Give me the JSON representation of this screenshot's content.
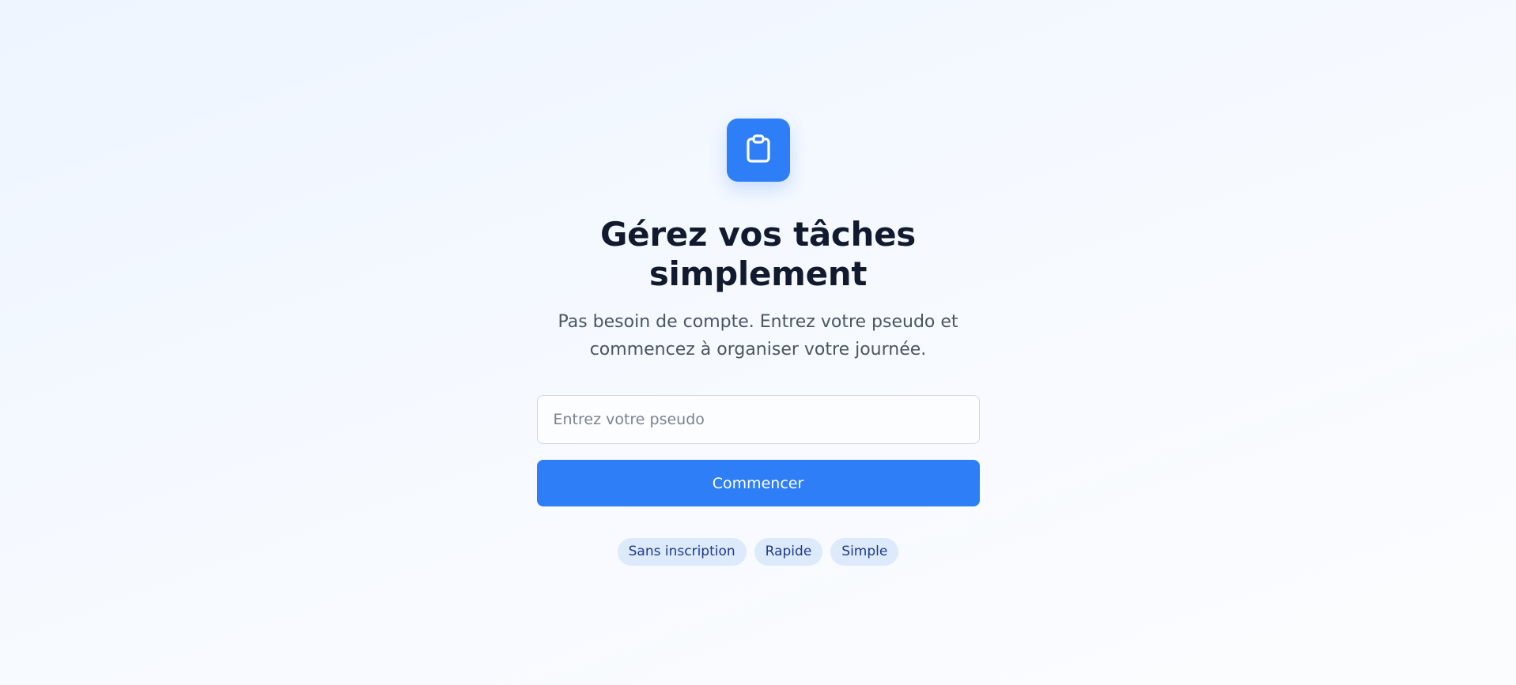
{
  "hero": {
    "icon": "clipboard-icon",
    "accent_color": "#2e7ef7",
    "title": "Gérez vos tâches simplement",
    "subtitle": "Pas besoin de compte. Entrez votre pseudo et commencez à organiser votre journée."
  },
  "form": {
    "pseudo_placeholder": "Entrez votre pseudo",
    "pseudo_value": "",
    "submit_label": "Commencer"
  },
  "tags": [
    {
      "label": "Sans inscription"
    },
    {
      "label": "Rapide"
    },
    {
      "label": "Simple"
    }
  ]
}
